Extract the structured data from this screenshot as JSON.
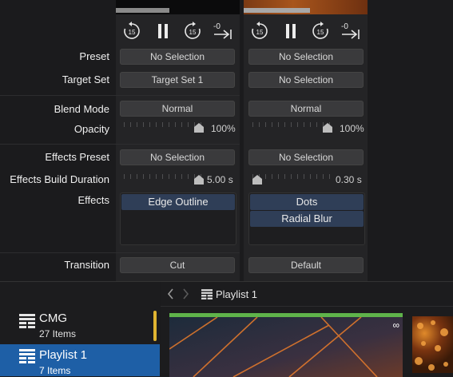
{
  "labels": {
    "preset": "Preset",
    "target_set": "Target Set",
    "blend_mode": "Blend Mode",
    "opacity": "Opacity",
    "effects_preset": "Effects Preset",
    "effects_build_duration": "Effects Build Duration",
    "effects": "Effects",
    "transition": "Transition"
  },
  "controls": {
    "rewind": "15",
    "forward": "15",
    "end": "-0"
  },
  "layers": [
    {
      "preset": "No Selection",
      "target_set": "Target Set 1",
      "blend_mode": "Normal",
      "opacity": "100%",
      "effects_preset": "No Selection",
      "build_duration": "5.00 s",
      "effects": [
        "Edge Outline"
      ],
      "transition": "Cut",
      "progress": 0.48
    },
    {
      "preset": "No Selection",
      "target_set": "No Selection",
      "blend_mode": "Normal",
      "opacity": "100%",
      "effects_preset": "No Selection",
      "build_duration": "0.30 s",
      "effects": [
        "Dots",
        "Radial Blur"
      ],
      "transition": "Default",
      "progress": 0.55
    }
  ],
  "sidebar": {
    "items": [
      {
        "name": "CMG",
        "count": "27 Items"
      },
      {
        "name": "Playlist 1",
        "count": "7 Items"
      }
    ]
  },
  "playlist": {
    "title": "Playlist 1",
    "loop_badge": "∞"
  },
  "colors": {
    "accent_blue": "#1e5fa6",
    "effect_item": "#2f3e57",
    "playing_green": "#5fb34a",
    "scroll_yellow": "#e0b431"
  }
}
